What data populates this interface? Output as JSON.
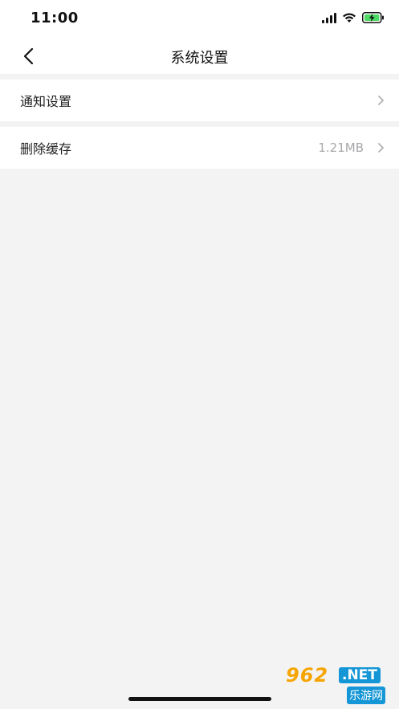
{
  "status_bar": {
    "time": "11:00",
    "battery_color": "#4cd964"
  },
  "nav": {
    "title": "系统设置",
    "back_icon": "chevron-left-icon"
  },
  "settings": {
    "items": [
      {
        "label": "通知设置",
        "value": "",
        "icon": "chevron-right-icon"
      },
      {
        "label": "删除缓存",
        "value": "1.21MB",
        "icon": "chevron-right-icon"
      }
    ]
  },
  "watermark": {
    "logo": "962",
    "net": ".NET",
    "sub": "乐游网"
  },
  "colors": {
    "background": "#f3f3f4",
    "card": "#ffffff",
    "secondary_text": "#a7a7ab",
    "watermark_orange": "#f6a400",
    "watermark_blue": "#1596d6"
  }
}
